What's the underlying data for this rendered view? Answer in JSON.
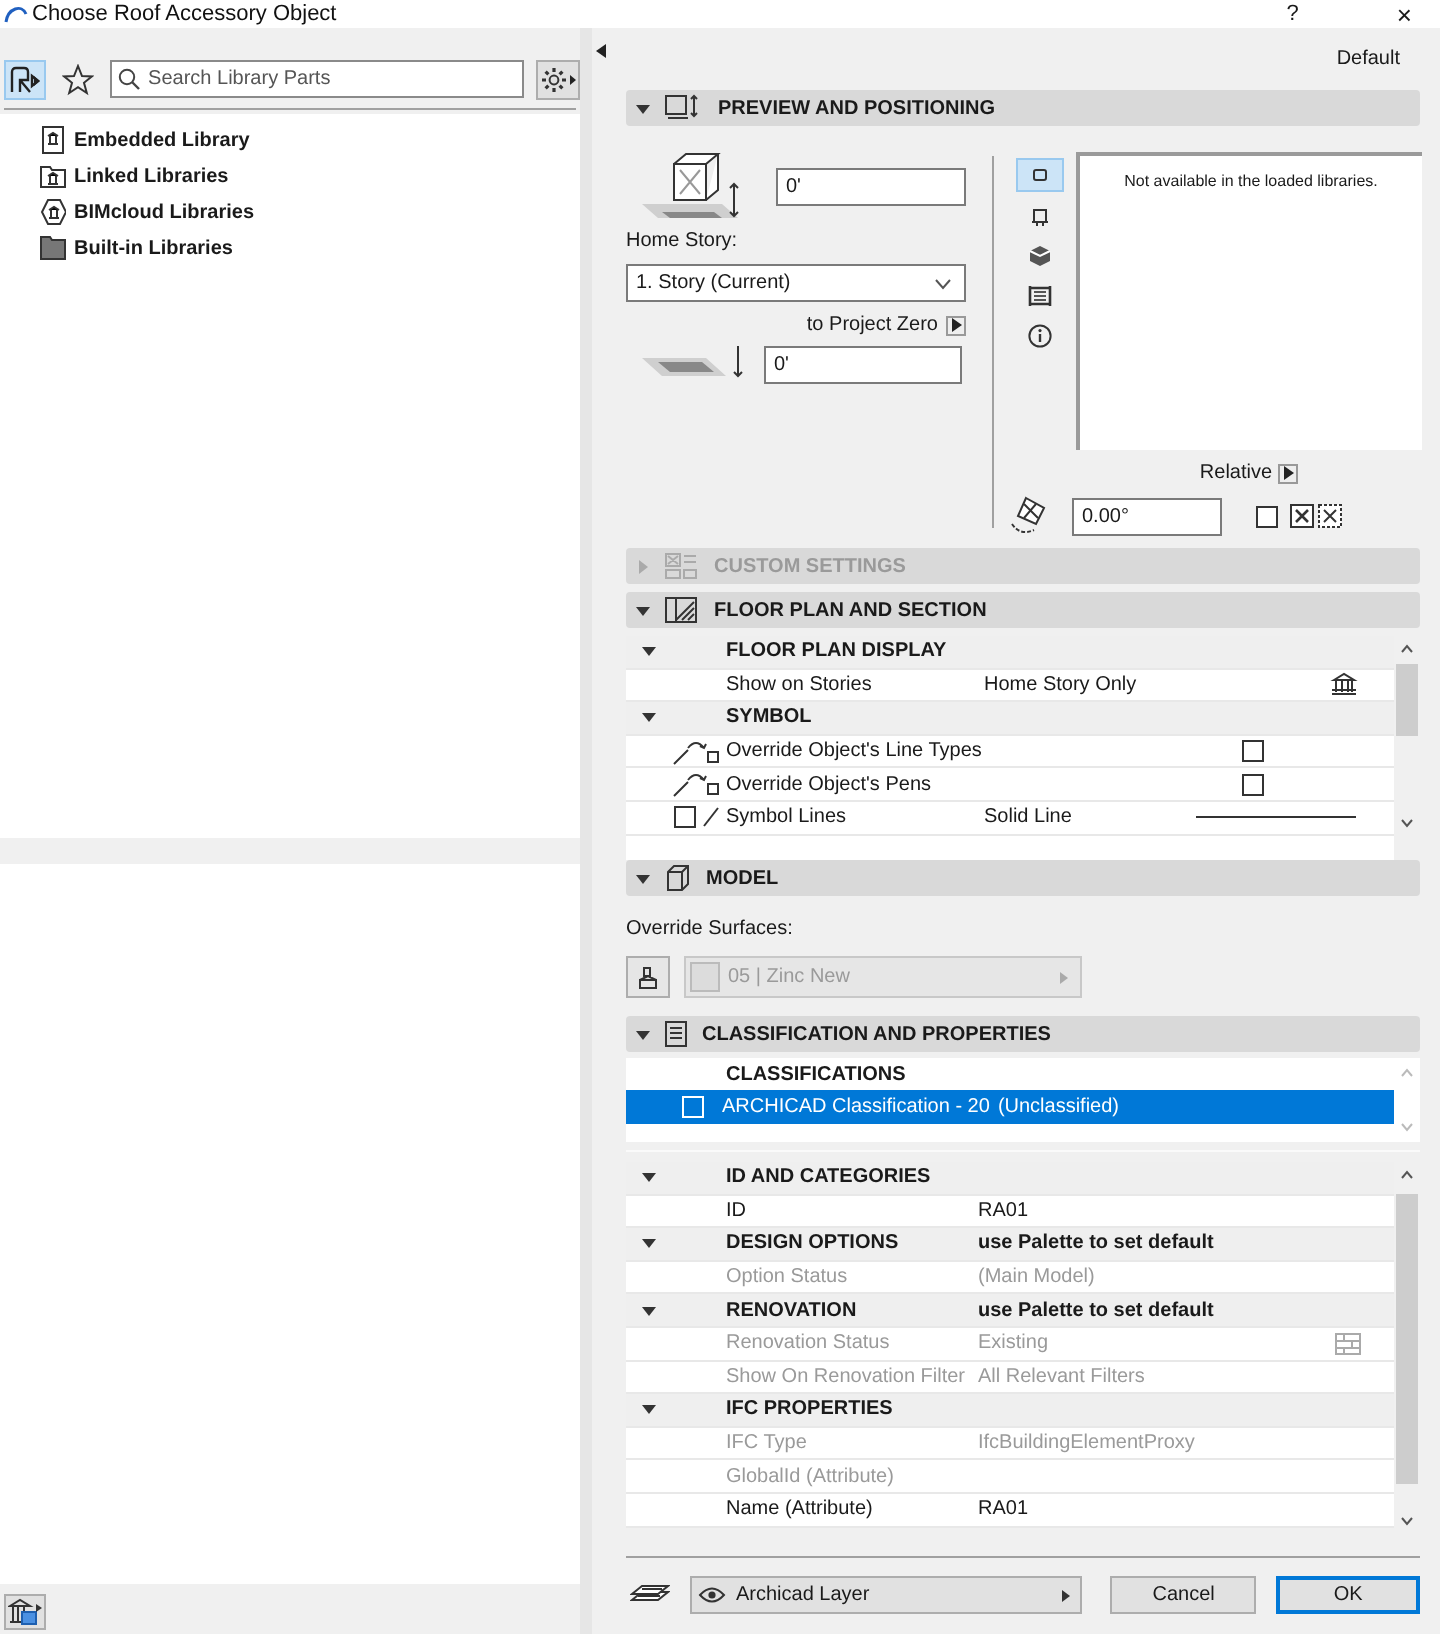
{
  "window": {
    "title": "Choose Roof Accessory Object",
    "help": "?",
    "close": "×"
  },
  "library": {
    "search": {
      "placeholder": "Search Library Parts"
    },
    "items": [
      {
        "label": "Embedded Library",
        "kind": "embedded"
      },
      {
        "label": "Linked Libraries",
        "kind": "linked"
      },
      {
        "label": "BIMcloud Libraries",
        "kind": "bimcloud"
      },
      {
        "label": "Built-in Libraries",
        "kind": "builtin"
      }
    ]
  },
  "settings_name": "Default",
  "preview": {
    "title": "PREVIEW AND POSITIONING",
    "expanded": true,
    "elevation": "0'",
    "home_story_label": "Home Story:",
    "home_story": "1. Story (Current)",
    "zero_label": "to Project Zero",
    "zero_value": "0'",
    "message": "Not available in the loaded libraries.",
    "relative_label": "Relative",
    "angle": "0.00°",
    "view_modes": [
      {
        "kind": "plan",
        "selected": true
      },
      {
        "kind": "section",
        "selected": false
      },
      {
        "kind": "cube",
        "selected": false
      },
      {
        "kind": "elevation",
        "selected": false
      },
      {
        "kind": "info",
        "selected": false
      }
    ]
  },
  "custom_settings": {
    "title": "CUSTOM SETTINGS",
    "expanded": false,
    "disabled": true
  },
  "floor_plan": {
    "title": "FLOOR PLAN AND SECTION",
    "expanded": true,
    "rows": [
      {
        "kind": "group",
        "label": "FLOOR PLAN DISPLAY",
        "expanded": true
      },
      {
        "kind": "value",
        "label": "Show on Stories",
        "value": "Home Story Only"
      },
      {
        "kind": "group",
        "label": "SYMBOL",
        "expanded": true
      },
      {
        "kind": "override",
        "label": "Override Object's Line Types",
        "checked": false
      },
      {
        "kind": "override",
        "label": "Override Object's Pens",
        "checked": false
      },
      {
        "kind": "line",
        "label": "Symbol Lines",
        "value": "Solid Line",
        "checked": false
      }
    ]
  },
  "model": {
    "title": "MODEL",
    "expanded": true,
    "surfaces_label": "Override Surfaces:",
    "surface": "05 | Zinc New"
  },
  "classification": {
    "title": "CLASSIFICATION AND PROPERTIES",
    "expanded": true,
    "heading": "CLASSIFICATIONS",
    "classifications": [
      {
        "label": "ARCHICAD Classification - 20",
        "value": "(Unclassified)",
        "selected": true,
        "checked": false
      }
    ],
    "properties": [
      {
        "kind": "group",
        "label": "ID AND CATEGORIES",
        "expanded": true
      },
      {
        "kind": "field",
        "label": "ID",
        "value": "RA01",
        "disabled": false
      },
      {
        "kind": "group",
        "label": "DESIGN OPTIONS",
        "value": "use Palette to set default",
        "expanded": true
      },
      {
        "kind": "field",
        "label": "Option Status",
        "value": "(Main Model)",
        "disabled": true
      },
      {
        "kind": "group",
        "label": "RENOVATION",
        "value": "use Palette to set default",
        "expanded": true
      },
      {
        "kind": "iconfield",
        "label": "Renovation Status",
        "value": "Existing",
        "disabled": true
      },
      {
        "kind": "field",
        "label": "Show On Renovation Filter",
        "value": "All Relevant Filters",
        "disabled": true
      },
      {
        "kind": "group",
        "label": "IFC PROPERTIES",
        "expanded": true
      },
      {
        "kind": "field",
        "label": "IFC Type",
        "value": "IfcBuildingElementProxy",
        "disabled": true
      },
      {
        "kind": "field",
        "label": "GlobalId (Attribute)",
        "disabled": true
      },
      {
        "kind": "field",
        "label": "Name (Attribute)",
        "value": "RA01",
        "disabled": false
      }
    ]
  },
  "footer": {
    "layer": "Archicad Layer",
    "cancel": "Cancel",
    "ok": "OK"
  }
}
